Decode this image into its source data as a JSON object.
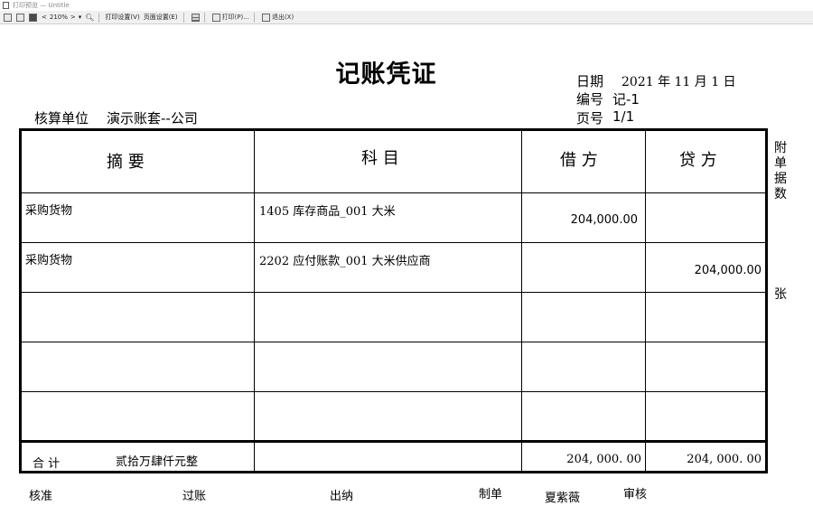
{
  "window": {
    "title": "打印预览 — Untitle"
  },
  "toolbar": {
    "zoom": "210%",
    "print_setup": "打印设置(V)",
    "page_setup": "页面设置(E)",
    "print": "打印(P)...",
    "exit": "退出(X)"
  },
  "voucher": {
    "title": "记账凭证",
    "date_label": "日期",
    "date_value": "2021 年 11 月  1   日",
    "number_label": "编号",
    "number_value": "记-1",
    "page_label": "页号",
    "page_value": "1/1",
    "unit_label": "核算单位",
    "unit_value": "演示账套--公司",
    "columns": {
      "summary": "摘    要",
      "account": "科    目",
      "debit": "借    方",
      "credit": "贷    方"
    },
    "rows": [
      {
        "summary": "采购货物",
        "account": "1405 库存商品_001 大米",
        "debit": "204,000.00",
        "credit": ""
      },
      {
        "summary": "采购货物",
        "account": "2202 应付账款_001 大米供应商",
        "debit": "",
        "credit": "204,000.00"
      }
    ],
    "total_label": "合  计",
    "total_words": "贰拾万肆仟元整",
    "total_debit": "204, 000. 00",
    "total_credit": "204, 000. 00",
    "attachment_label": "附单据数",
    "attachment_unit": "张"
  },
  "footer": {
    "approver_label": "核准",
    "posted_label": "过账",
    "cashier_label": "出纳",
    "preparer_label": "制单",
    "preparer_name": "夏紫薇",
    "reviewer_label": "审核"
  }
}
